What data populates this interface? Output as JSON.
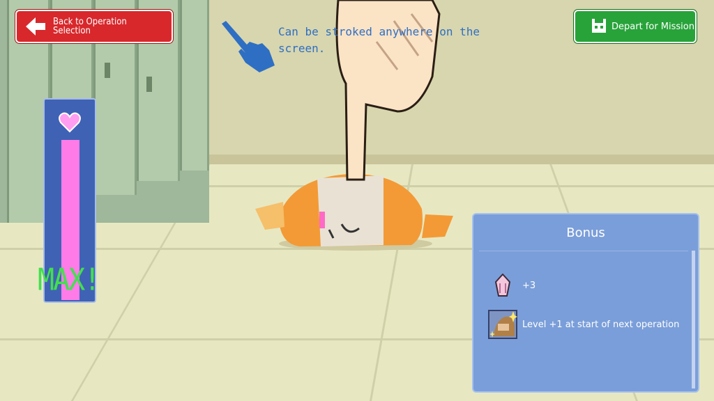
{
  "header": {
    "back_label_line1": "Back to Operation",
    "back_label_line2": "Selection",
    "depart_label": "Depart for Mission"
  },
  "hint": {
    "line1": "Can be stroked anywhere on the",
    "line2": "screen."
  },
  "affection_gauge": {
    "status": "MAX!",
    "level": 1.0,
    "fill_color": "#ff7be8",
    "icon": "heart-icon"
  },
  "bonus_panel": {
    "title": "Bonus",
    "items": [
      {
        "icon": "gem-icon",
        "text": "+3"
      },
      {
        "icon": "portrait-icon",
        "text": "Level +1 at start of next operation"
      }
    ]
  },
  "colors": {
    "back_button": "#d8282c",
    "depart_button": "#28a33a",
    "panel": "#7a9ed9",
    "hint_text": "#2e6fc4"
  }
}
